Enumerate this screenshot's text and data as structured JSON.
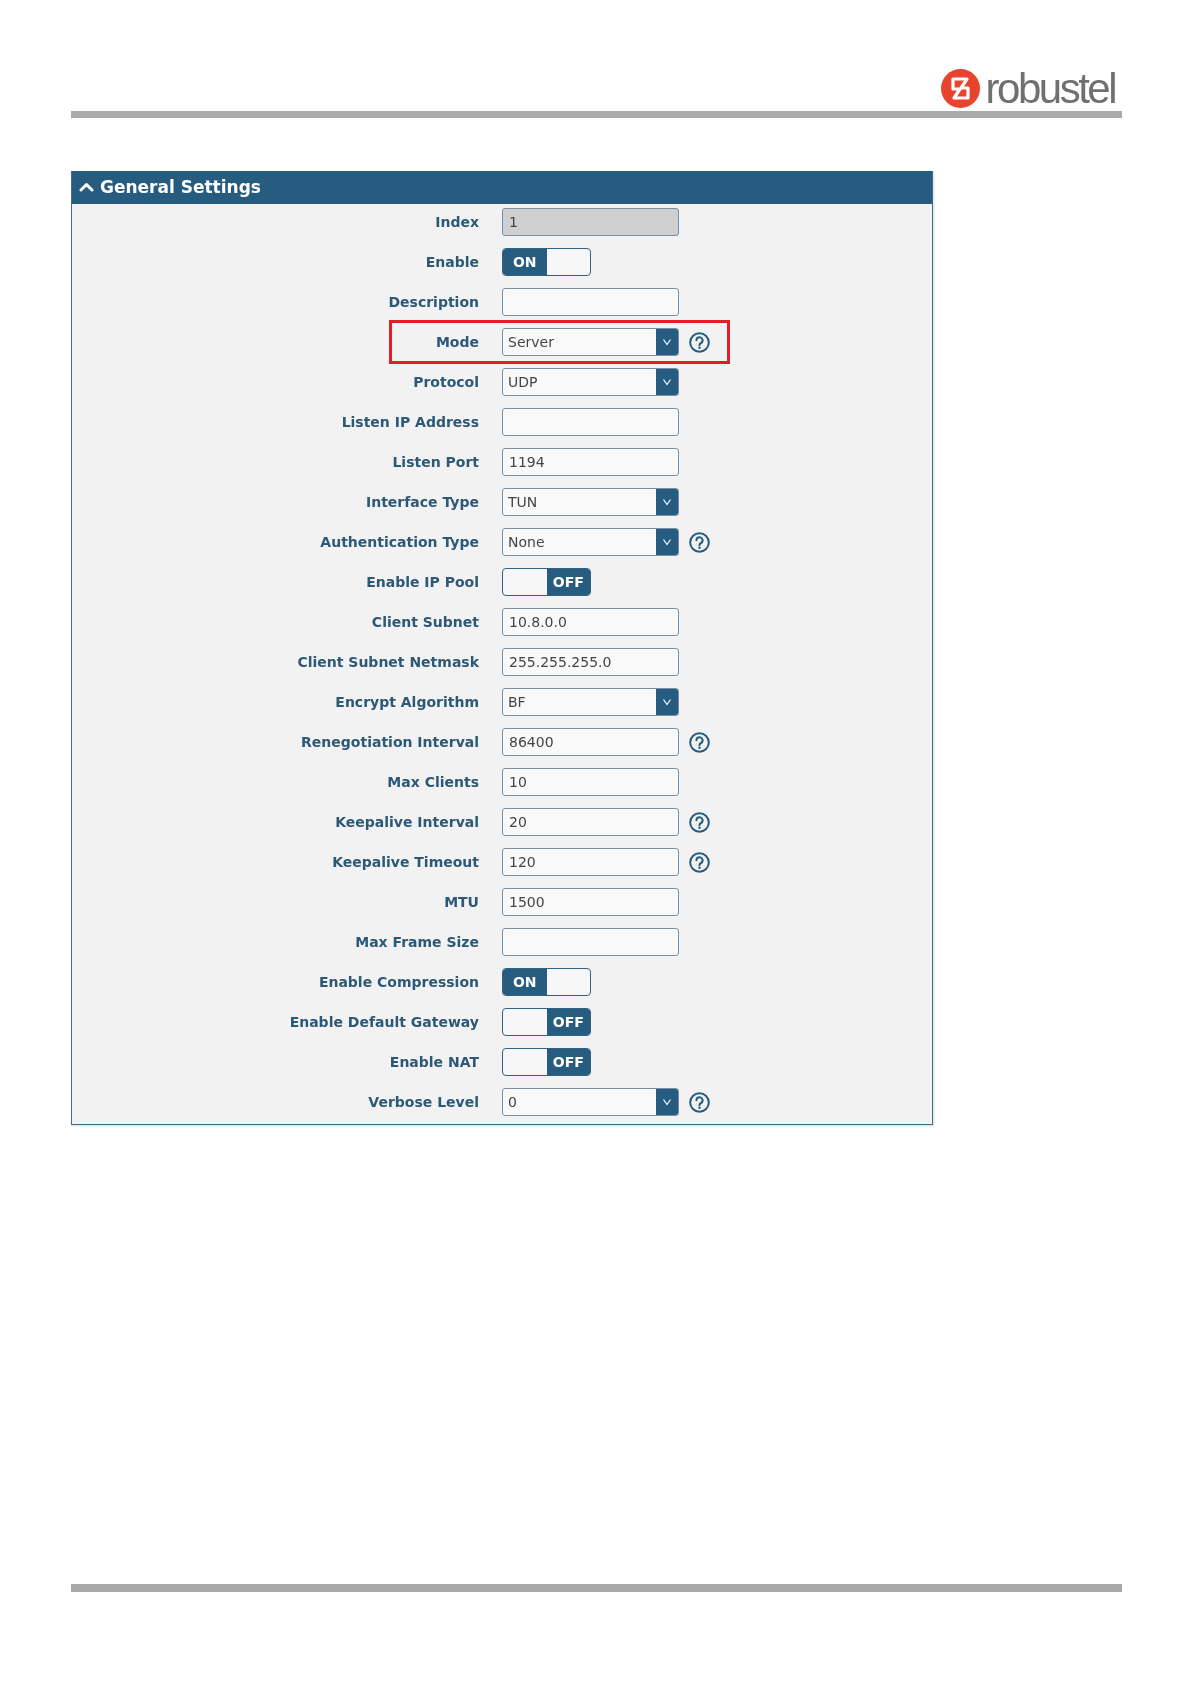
{
  "header": {
    "logo_text": "robustel"
  },
  "panel": {
    "title": "General Settings",
    "expanded": true,
    "fields": [
      {
        "kind": "text",
        "label": "Index",
        "value": "1",
        "disabled": true,
        "help": false,
        "highlighted": false
      },
      {
        "kind": "toggle",
        "label": "Enable",
        "on": true,
        "text": "ON",
        "disabled": false,
        "help": false,
        "highlighted": false
      },
      {
        "kind": "text",
        "label": "Description",
        "disabled": false,
        "help": false,
        "highlighted": false
      },
      {
        "kind": "select",
        "label": "Mode",
        "value": "Server",
        "disabled": false,
        "help": true,
        "highlighted": true
      },
      {
        "kind": "select",
        "label": "Protocol",
        "value": "UDP",
        "disabled": false,
        "help": false,
        "highlighted": false
      },
      {
        "kind": "text",
        "label": "Listen IP Address",
        "disabled": false,
        "help": false,
        "highlighted": false
      },
      {
        "kind": "text",
        "label": "Listen Port",
        "value": "1194",
        "disabled": false,
        "help": false,
        "highlighted": false
      },
      {
        "kind": "select",
        "label": "Interface Type",
        "value": "TUN",
        "disabled": false,
        "help": false,
        "highlighted": false
      },
      {
        "kind": "select",
        "label": "Authentication Type",
        "value": "None",
        "disabled": false,
        "help": true,
        "highlighted": false
      },
      {
        "kind": "toggle",
        "label": "Enable IP Pool",
        "on": false,
        "text": "OFF",
        "disabled": false,
        "help": false,
        "highlighted": false
      },
      {
        "kind": "text",
        "label": "Client Subnet",
        "value": "10.8.0.0",
        "disabled": false,
        "help": false,
        "highlighted": false
      },
      {
        "kind": "text",
        "label": "Client Subnet Netmask",
        "value": "255.255.255.0",
        "disabled": false,
        "help": false,
        "highlighted": false
      },
      {
        "kind": "select",
        "label": "Encrypt Algorithm",
        "value": "BF",
        "disabled": false,
        "help": false,
        "highlighted": false
      },
      {
        "kind": "text",
        "label": "Renegotiation Interval",
        "value": "86400",
        "disabled": false,
        "help": true,
        "highlighted": false
      },
      {
        "kind": "text",
        "label": "Max Clients",
        "value": "10",
        "disabled": false,
        "help": false,
        "highlighted": false
      },
      {
        "kind": "text",
        "label": "Keepalive Interval",
        "value": "20",
        "disabled": false,
        "help": true,
        "highlighted": false
      },
      {
        "kind": "text",
        "label": "Keepalive Timeout",
        "value": "120",
        "disabled": false,
        "help": true,
        "highlighted": false
      },
      {
        "kind": "text",
        "label": "MTU",
        "value": "1500",
        "disabled": false,
        "help": false,
        "highlighted": false
      },
      {
        "kind": "text",
        "label": "Max Frame Size",
        "disabled": false,
        "help": false,
        "highlighted": false
      },
      {
        "kind": "toggle",
        "label": "Enable Compression",
        "on": true,
        "text": "ON",
        "disabled": false,
        "help": false,
        "highlighted": false
      },
      {
        "kind": "toggle",
        "label": "Enable Default Gateway",
        "on": false,
        "text": "OFF",
        "disabled": false,
        "help": false,
        "highlighted": false
      },
      {
        "kind": "toggle",
        "label": "Enable NAT",
        "on": false,
        "text": "OFF",
        "disabled": false,
        "help": false,
        "highlighted": false
      },
      {
        "kind": "select",
        "label": "Verbose Level",
        "value": "0",
        "disabled": false,
        "help": true,
        "highlighted": false
      }
    ]
  }
}
